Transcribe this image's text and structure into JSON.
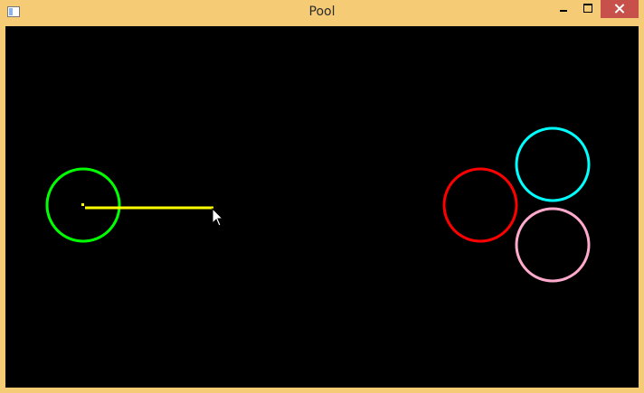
{
  "window": {
    "title": "Pool",
    "icon": "app-icon",
    "controls": [
      "minimize-icon",
      "maximize-icon",
      "close-icon"
    ],
    "frame_color": "#f5cc75",
    "close_color": "#c7504b"
  },
  "game": {
    "background": "#000000",
    "balls": [
      {
        "name": "cue-ball",
        "color": "#00ff00"
      },
      {
        "name": "red-ball",
        "color": "#ff0000"
      },
      {
        "name": "cyan-ball",
        "color": "#00ffff"
      },
      {
        "name": "pink-ball",
        "color": "#ffaacc"
      }
    ],
    "cue": {
      "color": "#ffff00"
    },
    "pointer": "mouse-pointer-icon"
  }
}
